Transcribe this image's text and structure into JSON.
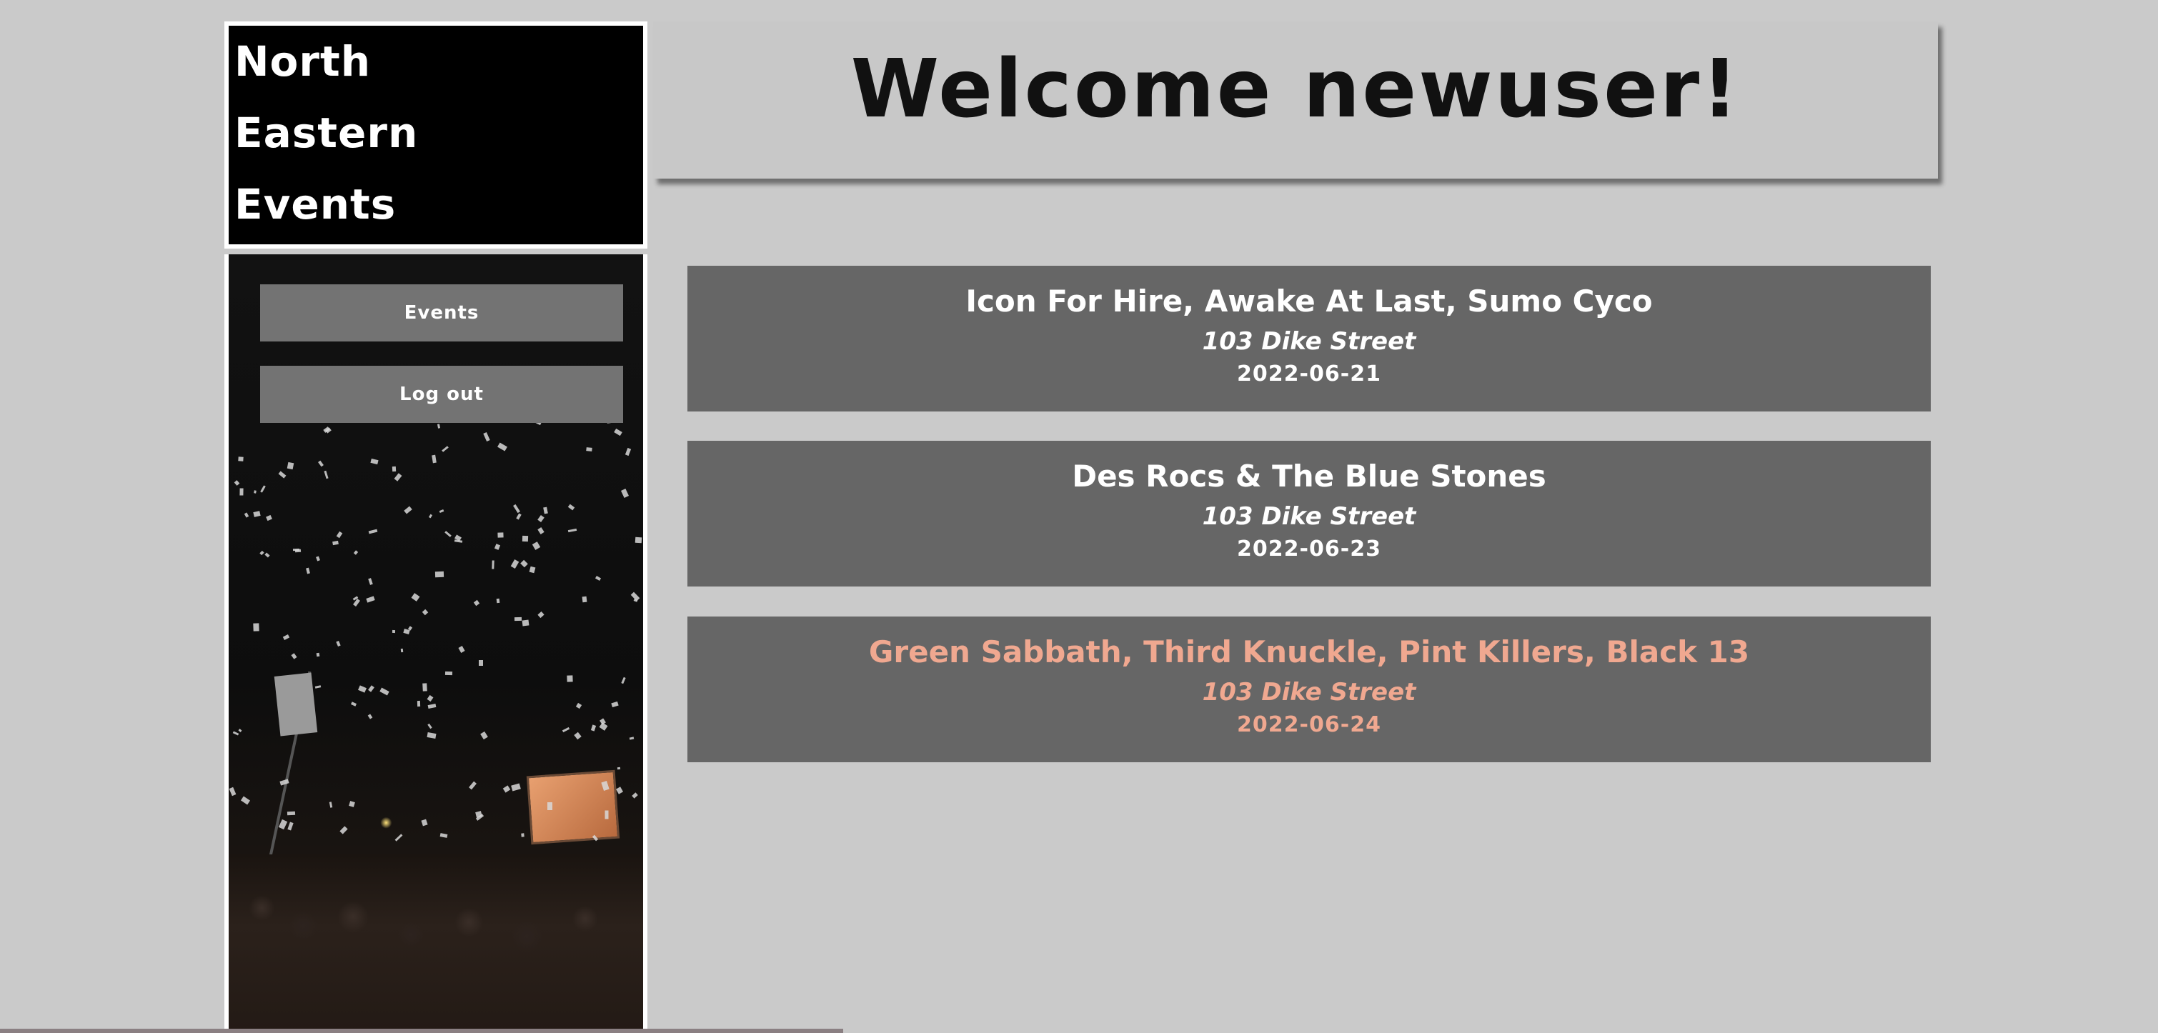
{
  "brand": {
    "lines": [
      "North",
      "Eastern",
      "Events"
    ]
  },
  "sidebar": {
    "buttons": [
      {
        "label": "Events"
      },
      {
        "label": "Log out"
      }
    ]
  },
  "header": {
    "title": "Welcome newuser!"
  },
  "events": [
    {
      "title": "Icon For Hire, Awake At Last, Sumo Cyco",
      "venue": "103 Dike Street",
      "date": "2022-06-21"
    },
    {
      "title": "Des Rocs & The Blue Stones",
      "venue": "103 Dike Street",
      "date": "2022-06-23"
    },
    {
      "title": "Green Sabbath, Third Knuckle, Pint Killers, Black 13",
      "venue": "103 Dike Street",
      "date": "2022-06-24"
    }
  ],
  "colors": {
    "background": "#cacaca",
    "card": "#666666",
    "button": "#737373",
    "hover_text": "#f0a890"
  }
}
